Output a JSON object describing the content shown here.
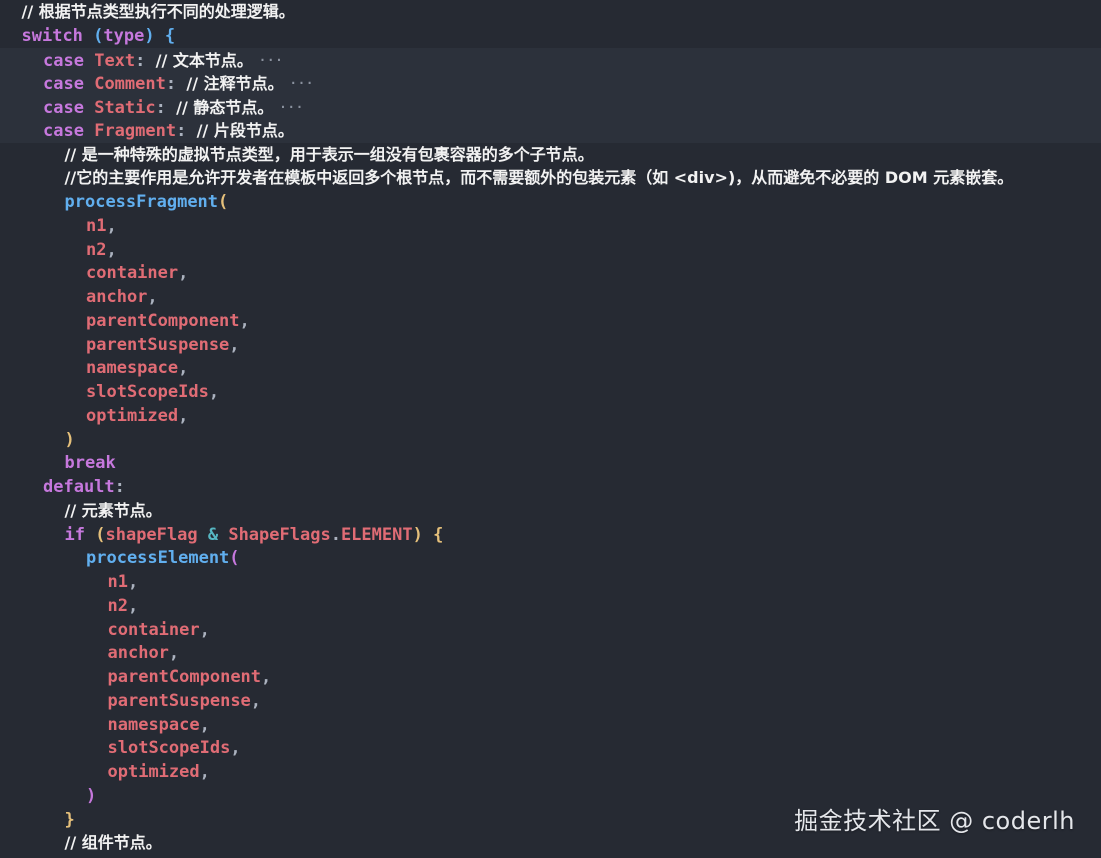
{
  "theme": {
    "background": "#262a33",
    "highlight": "#2c313b",
    "colors": {
      "comment": "#f2f2f2",
      "keyword": "#c678dd",
      "ident": "#e06c75",
      "fn": "#61afef",
      "paren": "#e5c07b",
      "paren2": "#c678dd",
      "punct": "#abb2bf",
      "op": "#56b6c2",
      "plain": "#abb2bf",
      "brace": "#d19a66"
    }
  },
  "lines": [
    {
      "indent": 1,
      "tokens": [
        {
          "t": "// 根据节点类型执行不同的处理逻辑。",
          "c": "comment"
        }
      ]
    },
    {
      "indent": 1,
      "tokens": [
        {
          "t": "switch",
          "c": "keyword"
        },
        {
          "t": " ",
          "c": "plain"
        },
        {
          "t": "(",
          "c": "fn"
        },
        {
          "t": "type",
          "c": "keyword"
        },
        {
          "t": ")",
          "c": "fn"
        },
        {
          "t": " {",
          "c": "fn"
        }
      ]
    },
    {
      "indent": 2,
      "highlight": true,
      "fold": true,
      "tokens": [
        {
          "t": "case",
          "c": "keyword"
        },
        {
          "t": " ",
          "c": "plain"
        },
        {
          "t": "Text",
          "c": "ident"
        },
        {
          "t": ": ",
          "c": "punct"
        },
        {
          "t": "// 文本节点。",
          "c": "comment"
        }
      ]
    },
    {
      "indent": 2,
      "highlight": true,
      "fold": true,
      "tokens": [
        {
          "t": "case",
          "c": "keyword"
        },
        {
          "t": " ",
          "c": "plain"
        },
        {
          "t": "Comment",
          "c": "ident"
        },
        {
          "t": ": ",
          "c": "punct"
        },
        {
          "t": "// 注释节点。",
          "c": "comment"
        }
      ]
    },
    {
      "indent": 2,
      "highlight": true,
      "fold": true,
      "tokens": [
        {
          "t": "case",
          "c": "keyword"
        },
        {
          "t": " ",
          "c": "plain"
        },
        {
          "t": "Static",
          "c": "ident"
        },
        {
          "t": ": ",
          "c": "punct"
        },
        {
          "t": "// 静态节点。",
          "c": "comment"
        }
      ]
    },
    {
      "indent": 2,
      "highlight": true,
      "tokens": [
        {
          "t": "case",
          "c": "keyword"
        },
        {
          "t": " ",
          "c": "plain"
        },
        {
          "t": "Fragment",
          "c": "ident"
        },
        {
          "t": ": ",
          "c": "punct"
        },
        {
          "t": "// 片段节点。",
          "c": "comment"
        }
      ]
    },
    {
      "indent": 3,
      "tokens": [
        {
          "t": "// 是一种特殊的虚拟节点类型，用于表示一组没有包裹容器的多个子节点。",
          "c": "comment"
        }
      ]
    },
    {
      "indent": 3,
      "tokens": [
        {
          "t": "//它的主要作用是允许开发者在模板中返回多个根节点，而不需要额外的包装元素（如 <div>)，从而避免不必要的 DOM 元素嵌套。",
          "c": "comment"
        }
      ]
    },
    {
      "indent": 3,
      "tokens": [
        {
          "t": "processFragment",
          "c": "fn"
        },
        {
          "t": "(",
          "c": "paren"
        }
      ]
    },
    {
      "indent": 4,
      "tokens": [
        {
          "t": "n1",
          "c": "ident"
        },
        {
          "t": ",",
          "c": "punct"
        }
      ]
    },
    {
      "indent": 4,
      "tokens": [
        {
          "t": "n2",
          "c": "ident"
        },
        {
          "t": ",",
          "c": "punct"
        }
      ]
    },
    {
      "indent": 4,
      "tokens": [
        {
          "t": "container",
          "c": "ident"
        },
        {
          "t": ",",
          "c": "punct"
        }
      ]
    },
    {
      "indent": 4,
      "tokens": [
        {
          "t": "anchor",
          "c": "ident"
        },
        {
          "t": ",",
          "c": "punct"
        }
      ]
    },
    {
      "indent": 4,
      "tokens": [
        {
          "t": "parentComponent",
          "c": "ident"
        },
        {
          "t": ",",
          "c": "punct"
        }
      ]
    },
    {
      "indent": 4,
      "tokens": [
        {
          "t": "parentSuspense",
          "c": "ident"
        },
        {
          "t": ",",
          "c": "punct"
        }
      ]
    },
    {
      "indent": 4,
      "tokens": [
        {
          "t": "namespace",
          "c": "ident"
        },
        {
          "t": ",",
          "c": "punct"
        }
      ]
    },
    {
      "indent": 4,
      "tokens": [
        {
          "t": "slotScopeIds",
          "c": "ident"
        },
        {
          "t": ",",
          "c": "punct"
        }
      ]
    },
    {
      "indent": 4,
      "tokens": [
        {
          "t": "optimized",
          "c": "ident"
        },
        {
          "t": ",",
          "c": "punct"
        }
      ]
    },
    {
      "indent": 3,
      "tokens": [
        {
          "t": ")",
          "c": "paren"
        }
      ]
    },
    {
      "indent": 3,
      "tokens": [
        {
          "t": "break",
          "c": "keyword"
        }
      ]
    },
    {
      "indent": 2,
      "tokens": [
        {
          "t": "default",
          "c": "keyword"
        },
        {
          "t": ":",
          "c": "punct"
        }
      ]
    },
    {
      "indent": 3,
      "tokens": [
        {
          "t": "// 元素节点。",
          "c": "comment"
        }
      ]
    },
    {
      "indent": 3,
      "tokens": [
        {
          "t": "if",
          "c": "keyword"
        },
        {
          "t": " ",
          "c": "plain"
        },
        {
          "t": "(",
          "c": "paren"
        },
        {
          "t": "shapeFlag",
          "c": "ident"
        },
        {
          "t": " & ",
          "c": "op"
        },
        {
          "t": "ShapeFlags",
          "c": "ident"
        },
        {
          "t": ".",
          "c": "punct"
        },
        {
          "t": "ELEMENT",
          "c": "ident"
        },
        {
          "t": ")",
          "c": "paren"
        },
        {
          "t": " {",
          "c": "paren"
        }
      ]
    },
    {
      "indent": 4,
      "tokens": [
        {
          "t": "processElement",
          "c": "fn"
        },
        {
          "t": "(",
          "c": "paren2"
        }
      ]
    },
    {
      "indent": 5,
      "tokens": [
        {
          "t": "n1",
          "c": "ident"
        },
        {
          "t": ",",
          "c": "punct"
        }
      ]
    },
    {
      "indent": 5,
      "tokens": [
        {
          "t": "n2",
          "c": "ident"
        },
        {
          "t": ",",
          "c": "punct"
        }
      ]
    },
    {
      "indent": 5,
      "tokens": [
        {
          "t": "container",
          "c": "ident"
        },
        {
          "t": ",",
          "c": "punct"
        }
      ]
    },
    {
      "indent": 5,
      "tokens": [
        {
          "t": "anchor",
          "c": "ident"
        },
        {
          "t": ",",
          "c": "punct"
        }
      ]
    },
    {
      "indent": 5,
      "tokens": [
        {
          "t": "parentComponent",
          "c": "ident"
        },
        {
          "t": ",",
          "c": "punct"
        }
      ]
    },
    {
      "indent": 5,
      "tokens": [
        {
          "t": "parentSuspense",
          "c": "ident"
        },
        {
          "t": ",",
          "c": "punct"
        }
      ]
    },
    {
      "indent": 5,
      "tokens": [
        {
          "t": "namespace",
          "c": "ident"
        },
        {
          "t": ",",
          "c": "punct"
        }
      ]
    },
    {
      "indent": 5,
      "tokens": [
        {
          "t": "slotScopeIds",
          "c": "ident"
        },
        {
          "t": ",",
          "c": "punct"
        }
      ]
    },
    {
      "indent": 5,
      "tokens": [
        {
          "t": "optimized",
          "c": "ident"
        },
        {
          "t": ",",
          "c": "punct"
        }
      ]
    },
    {
      "indent": 4,
      "tokens": [
        {
          "t": ")",
          "c": "paren2"
        }
      ]
    },
    {
      "indent": 3,
      "tokens": [
        {
          "t": "}",
          "c": "paren"
        }
      ]
    },
    {
      "indent": 3,
      "tokens": [
        {
          "t": "// 组件节点。",
          "c": "comment"
        }
      ]
    }
  ],
  "watermark": "掘金技术社区 @ coderlh",
  "fold_marker": "···"
}
